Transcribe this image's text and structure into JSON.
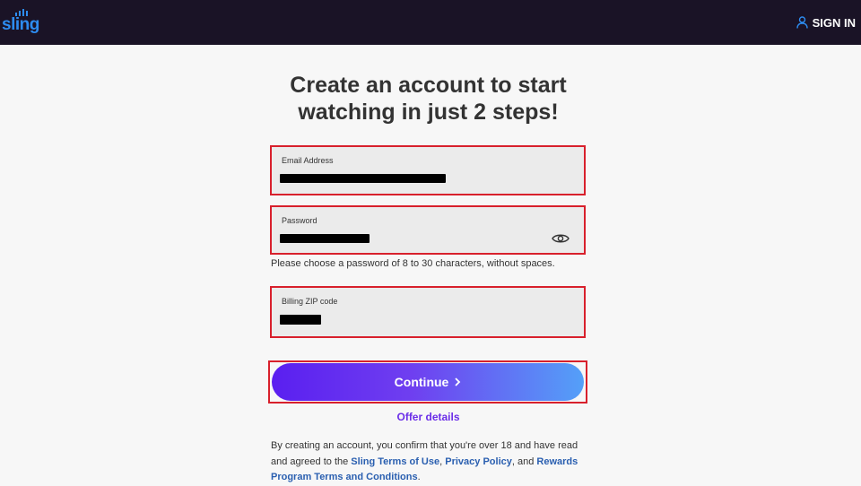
{
  "header": {
    "logo_text": "sling",
    "signin_label": "SIGN IN",
    "colors": {
      "bar": "#1a1326",
      "logo": "#2d8cf0"
    },
    "icons": {
      "signin": "user-icon"
    }
  },
  "main": {
    "title_line1": "Create an account to start",
    "title_line2": "watching in just 2 steps!",
    "email": {
      "label": "Email Address",
      "value_state": "redacted"
    },
    "password": {
      "label": "Password",
      "value_state": "redacted",
      "toggle_icon": "eye-icon"
    },
    "password_hint": "Please choose a password of 8 to 30 characters, without spaces.",
    "zip": {
      "label": "Billing ZIP code",
      "value_state": "redacted"
    },
    "continue_label": "Continue",
    "offer_details": "Offer details",
    "legal": {
      "part1": "By creating an account, you confirm that you're over 18 and have read and agreed to the ",
      "link1": "Sling Terms of Use",
      "part2": ", ",
      "link2": "Privacy Policy",
      "part3": ", and ",
      "link3": "Rewards Program Terms and Conditions",
      "part4": "."
    },
    "colors": {
      "highlight_border": "#d8202c",
      "button_start": "#5a1ff0",
      "button_end": "#54a0f8",
      "link": "#2a5fb0",
      "offer": "#6b2ee8"
    }
  }
}
